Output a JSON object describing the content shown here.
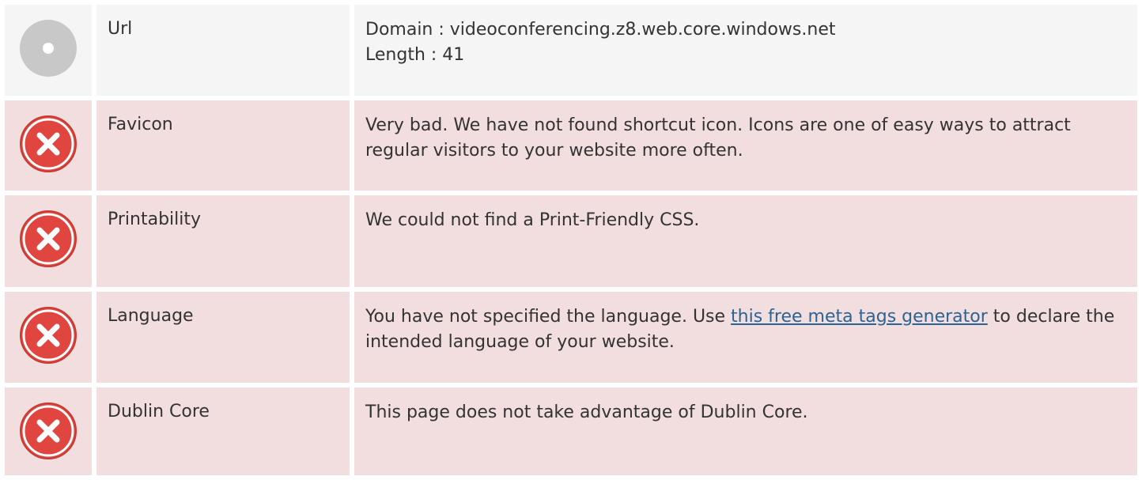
{
  "rows": [
    {
      "status": "info",
      "icon": "neutral-circle-icon",
      "label": "Url",
      "lines": [
        "Domain : videoconferencing.z8.web.core.windows.net",
        "Length : 41"
      ]
    },
    {
      "status": "error",
      "icon": "error-x-icon",
      "label": "Favicon",
      "text": "Very bad. We have not found shortcut icon. Icons are one of easy ways to attract regular visitors to your website more often."
    },
    {
      "status": "error",
      "icon": "error-x-icon",
      "label": "Printability",
      "text": "We could not find a Print-Friendly CSS."
    },
    {
      "status": "error",
      "icon": "error-x-icon",
      "label": "Language",
      "text_before": "You have not specified the language. Use ",
      "link_text": "this free meta tags generator",
      "text_after": " to declare the intended language of your website."
    },
    {
      "status": "error",
      "icon": "error-x-icon",
      "label": "Dublin Core",
      "text": "This page does not take advantage of Dublin Core."
    }
  ],
  "colors": {
    "neutral_row": "#f5f5f5",
    "error_row": "#f2dede",
    "error_icon": "#e0463f",
    "neutral_icon": "#c8c8c8",
    "link": "#2a6496"
  }
}
